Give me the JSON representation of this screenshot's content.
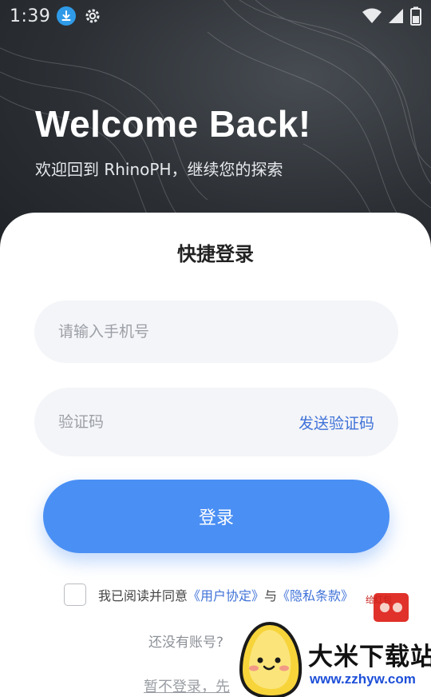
{
  "status_bar": {
    "time": "1:39",
    "icons": [
      "download-icon",
      "gear-icon",
      "wifi-icon",
      "signal-icon",
      "battery-icon"
    ]
  },
  "hero": {
    "title": "Welcome Back!",
    "subtitle": "欢迎回到 RhinoPH，继续您的探索"
  },
  "login": {
    "title": "快捷登录",
    "phone_placeholder": "请输入手机号",
    "phone_value": "",
    "code_placeholder": "验证码",
    "code_value": "",
    "send_code_label": "发送验证码",
    "submit_label": "登录",
    "agreement": {
      "checked": false,
      "prefix": "我已阅读并同意",
      "user_agreement": "《用户协定》",
      "connector": "与",
      "privacy_policy": "《隐私条款》"
    },
    "no_account_text": "还没有账号?",
    "skip_text": "暂不登录，先"
  },
  "watermark": {
    "brand": "大米下载站",
    "url": "www.zzhyw.com",
    "envelope_text": "给红包"
  },
  "colors": {
    "accent": "#4a8ff4",
    "link": "#3f72d8",
    "hero_bg": "#2c3035",
    "field_bg": "#f4f5f8"
  }
}
